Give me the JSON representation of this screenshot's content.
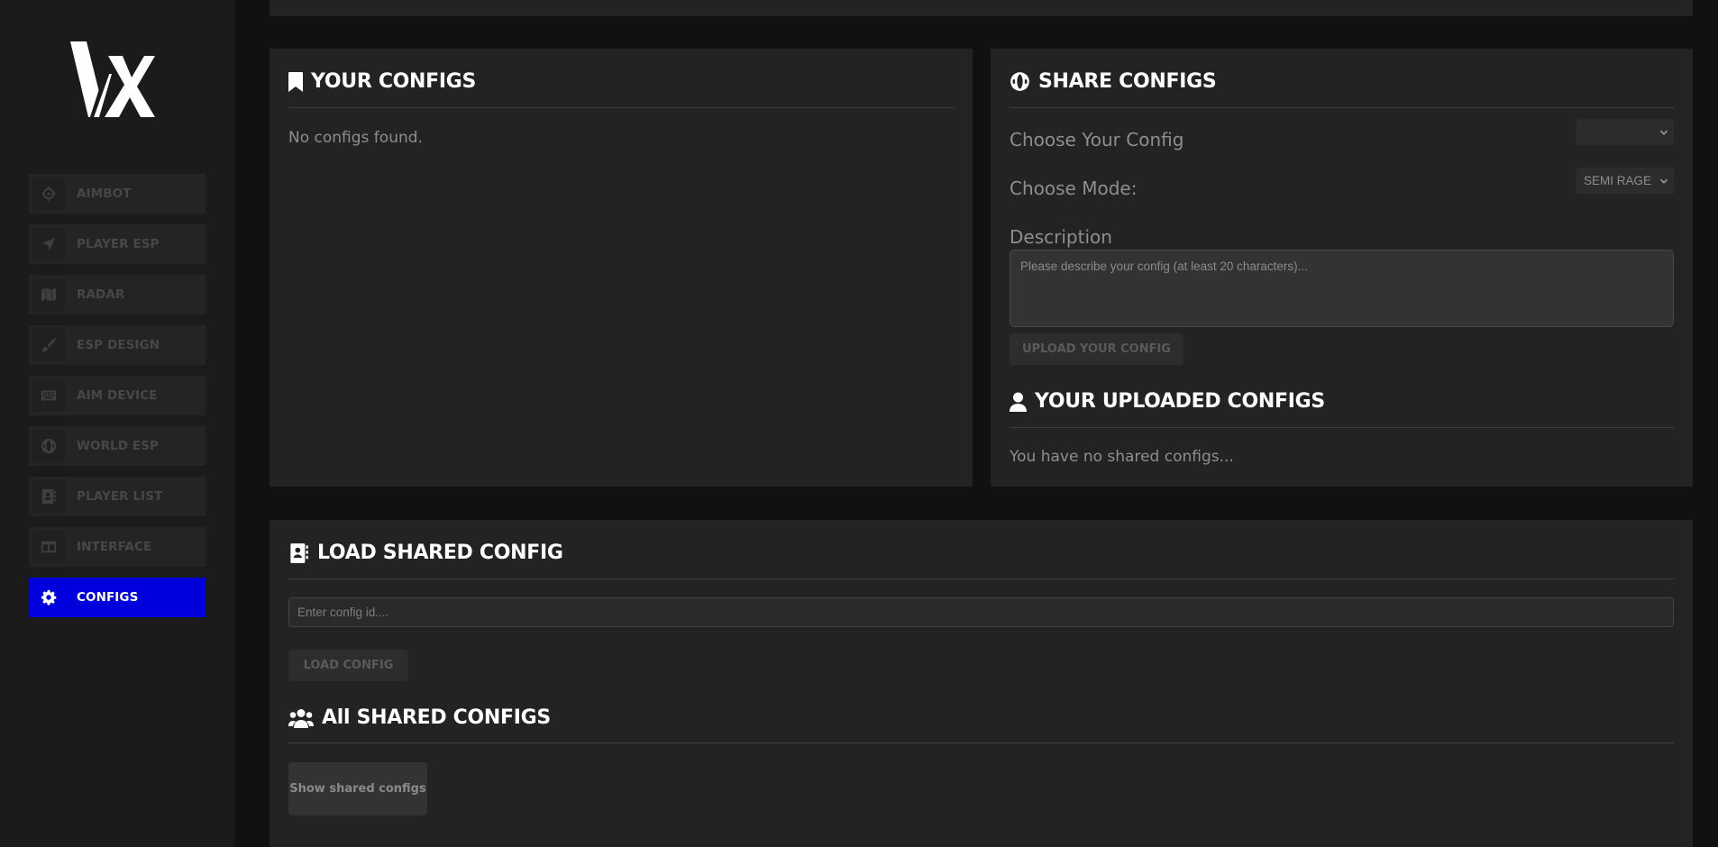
{
  "logo": {
    "text": "VX"
  },
  "sidebar": {
    "items": [
      {
        "label": "AIMBOT",
        "icon": "crosshair-icon"
      },
      {
        "label": "PLAYER ESP",
        "icon": "location-arrow-icon"
      },
      {
        "label": "RADAR",
        "icon": "map-icon"
      },
      {
        "label": "ESP DESIGN",
        "icon": "paintbrush-icon"
      },
      {
        "label": "AIM DEVICE",
        "icon": "keyboard-icon"
      },
      {
        "label": "WORLD ESP",
        "icon": "globe-icon"
      },
      {
        "label": "PLAYER LIST",
        "icon": "address-book-icon"
      },
      {
        "label": "INTERFACE",
        "icon": "window-icon"
      },
      {
        "label": "CONFIGS",
        "icon": "gear-icon",
        "active": true
      }
    ],
    "active_color": "#0000dc"
  },
  "your_configs": {
    "title": "YOUR CONFIGS",
    "empty_text": "No configs found."
  },
  "share_configs": {
    "title": "SHARE CONFIGS",
    "choose_config_label": "Choose Your Config",
    "choose_config_value": "",
    "choose_mode_label": "Choose Mode:",
    "choose_mode_value": "SEMI RAGE",
    "description_label": "Description",
    "description_placeholder": "Please describe your config (at least 20 characters)...",
    "upload_button": "UPLOAD YOUR CONFIG"
  },
  "uploaded_configs": {
    "title": "YOUR UPLOADED CONFIGS",
    "empty_text": "You have no shared configs..."
  },
  "load_shared": {
    "title": "LOAD SHARED CONFIG",
    "input_placeholder": "Enter config id....",
    "load_button": "LOAD CONFIG"
  },
  "all_shared": {
    "title": "All SHARED CONFIGS",
    "show_button": "Show shared configs"
  }
}
